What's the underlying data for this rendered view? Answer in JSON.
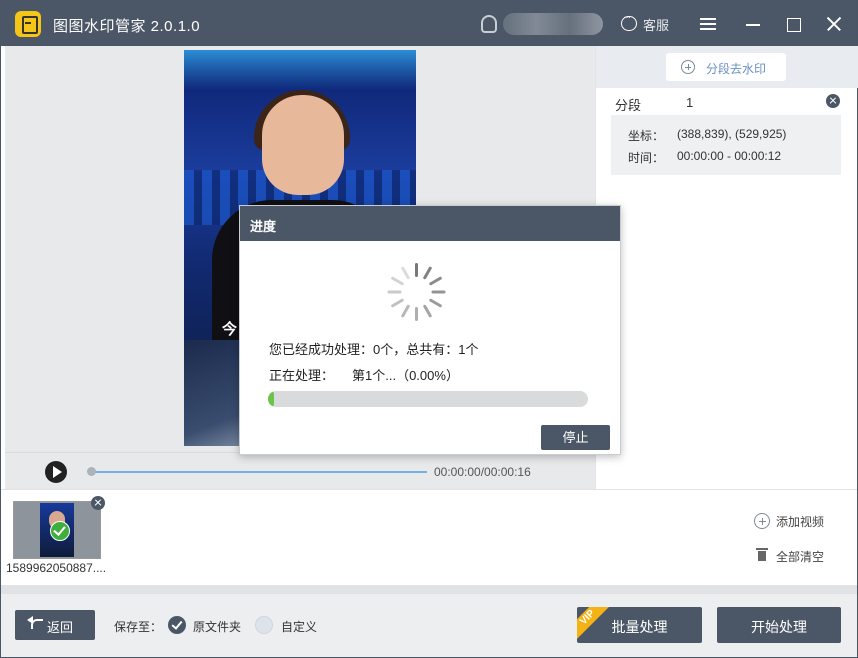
{
  "titlebar": {
    "app_title": "图图水印管家  2.0.1.0",
    "service_label": "客服",
    "icons": [
      "app-logo",
      "user-icon",
      "service-icon",
      "menu-icon",
      "minimize-icon",
      "maximize-icon",
      "close-icon"
    ]
  },
  "video": {
    "caption_char": "今"
  },
  "player": {
    "time": "00:00:00/00:00:16",
    "position_fraction": 0.0
  },
  "right_panel": {
    "segment_button_label": "分段去水印",
    "segment_label": "分段",
    "segment_index": "1",
    "coords_key": "坐标：",
    "coords_value": "(388,839), (529,925)",
    "time_key": "时间：",
    "time_value": "00:00:00 - 00:00:12"
  },
  "file_strip": {
    "files": [
      {
        "name": "1589962050887....",
        "status": "checked"
      }
    ],
    "add_video_label": "添加视频",
    "clear_all_label": "全部清空"
  },
  "footer": {
    "back_label": "返回",
    "save_to_label": "保存至：",
    "options": [
      {
        "label": "原文件夹",
        "selected": true
      },
      {
        "label": "自定义",
        "selected": false
      }
    ],
    "vip_badge": "VIP",
    "batch_label": "批量处理",
    "start_label": "开始处理"
  },
  "dialog": {
    "title": "进度",
    "line1": "您已经成功处理：0个，总共有：1个",
    "line2_label": "正在处理：",
    "line2_value": "第1个...（0.00%）",
    "progress_fraction": 0.0,
    "stop_label": "停止"
  },
  "colors": {
    "titlebar": "#4b5766",
    "accent_green": "#6cc24a",
    "vip_yellow": "#f3b315",
    "link_blue": "#6a8fc4"
  }
}
